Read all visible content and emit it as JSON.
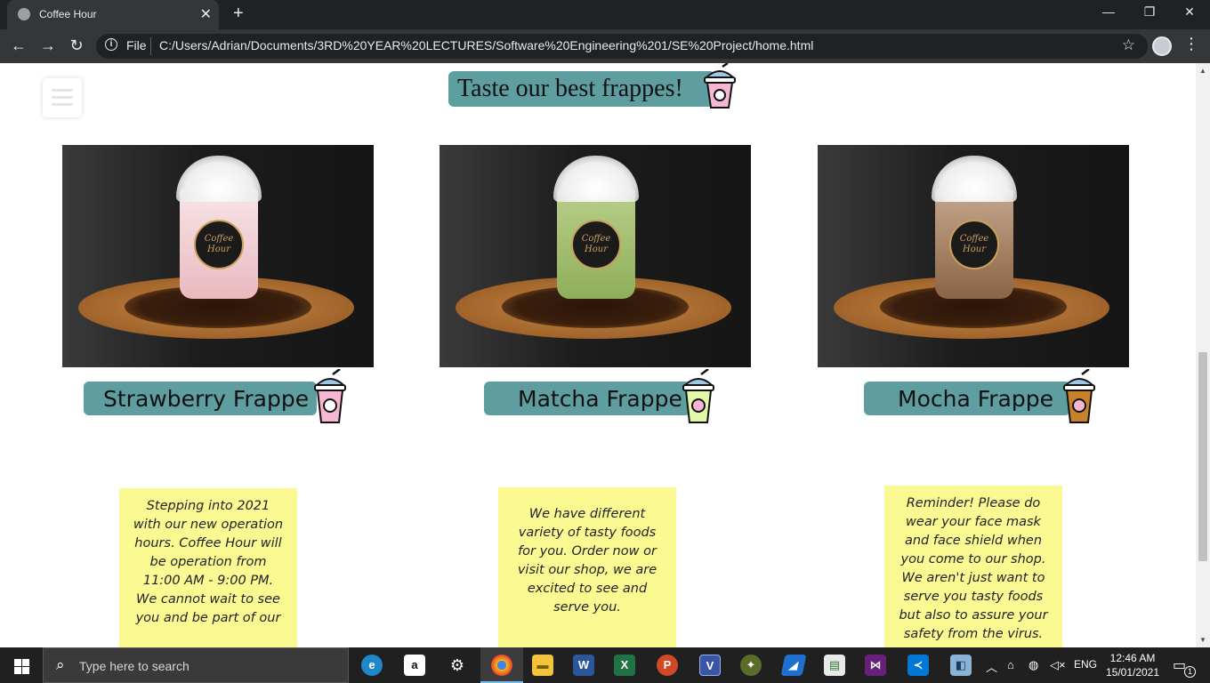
{
  "browser": {
    "tab_title": "Coffee Hour",
    "tab_close": "✕",
    "new_tab": "+",
    "minimize": "—",
    "restore": "❐",
    "close_window": "✕",
    "back": "←",
    "forward": "→",
    "reload": "↻",
    "scheme_label": "File",
    "url": "C:/Users/Adrian/Documents/3RD%20YEAR%20LECTURES/Software%20Engineering%201/SE%20Project/home.html",
    "bookmark": "☆",
    "menu": "⋮"
  },
  "page": {
    "headline": "Taste our best frappes!",
    "products": [
      {
        "name": "Strawberry Frappe",
        "drink_color": "#f2c6cc",
        "cup_icon_color": "#f7b6d2"
      },
      {
        "name": "Matcha Frappe",
        "drink_color": "#9dba6a",
        "cup_icon_color": "#e3f7a8"
      },
      {
        "name": "Mocha Frappe",
        "drink_color": "#a88062",
        "cup_icon_color": "#c8822c"
      }
    ],
    "logo_text": "Coffee Hour",
    "notes": [
      "Stepping into 2021 with our new operation hours. Coffee Hour will be operation from 11:00 AM - 9:00 PM. We cannot wait to see you and be part of our",
      "We have different variety of tasty foods for you. Order now or visit our shop, we are excited to see and serve you.",
      "Reminder! Please do wear your face mask and face shield when you come to our shop. We aren't just want to serve you tasty foods but also to assure your safety from the virus."
    ]
  },
  "colors": {
    "accent": "#5f9ea0",
    "note_bg": "#fbfa92"
  },
  "taskbar": {
    "search_placeholder": "Type here to search",
    "apps": [
      "edge",
      "amazon",
      "settings",
      "chrome",
      "file-explorer",
      "word",
      "excel",
      "powerpoint",
      "visio",
      "app-8",
      "app-9",
      "app-10",
      "visual-studio",
      "vs-code",
      "app-14"
    ],
    "language": "ENG",
    "time": "12:46 AM",
    "date": "15/01/2021",
    "notification_count": "1"
  }
}
